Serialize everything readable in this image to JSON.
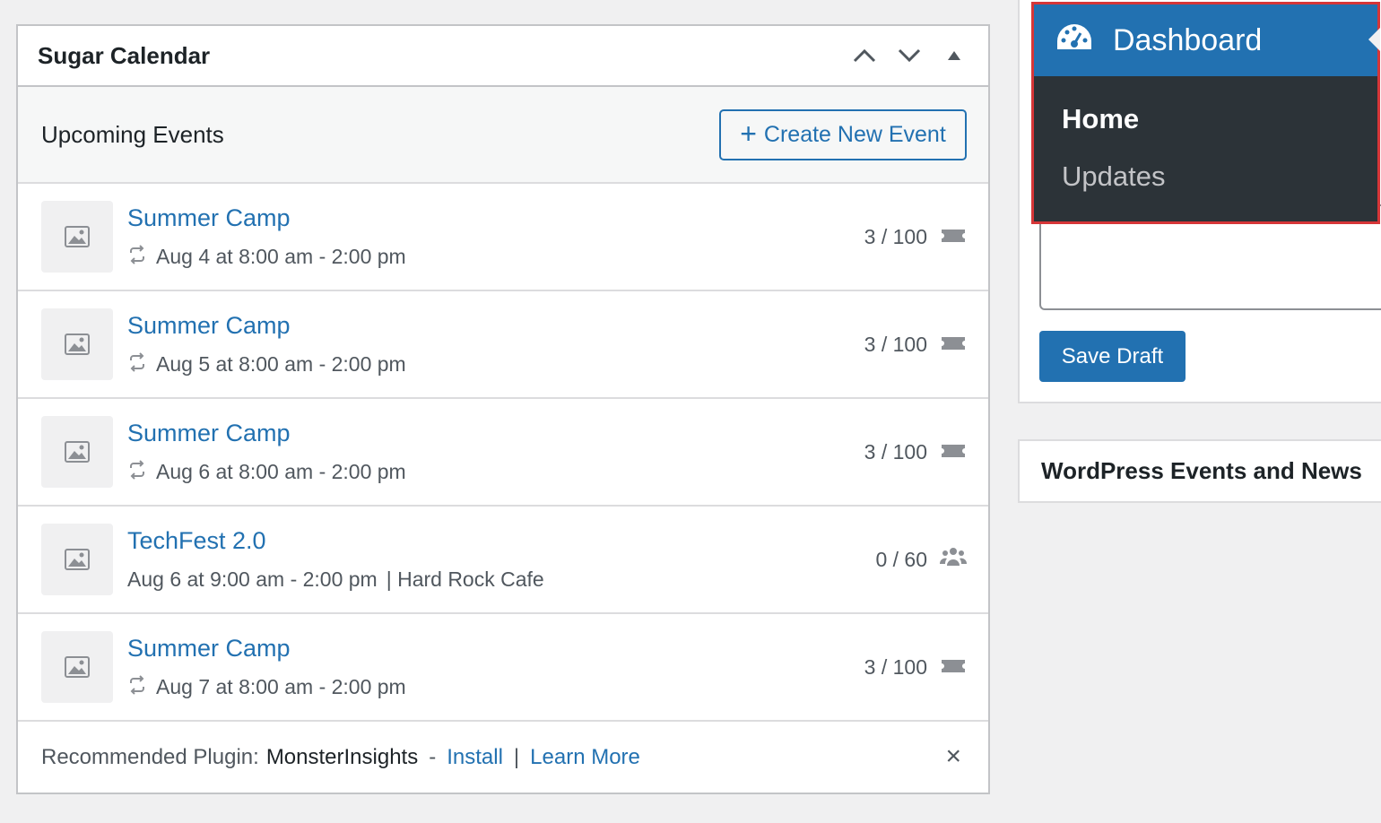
{
  "widget": {
    "title": "Sugar Calendar",
    "subtitle": "Upcoming Events",
    "create_label": "Create New Event",
    "events": [
      {
        "title": "Summer Camp",
        "meta": "Aug 4 at 8:00 am - 2:00 pm",
        "count": "3 / 100",
        "recurring": true,
        "icon": "ticket-icon"
      },
      {
        "title": "Summer Camp",
        "meta": "Aug 5 at 8:00 am - 2:00 pm",
        "count": "3 / 100",
        "recurring": true,
        "icon": "ticket-icon"
      },
      {
        "title": "Summer Camp",
        "meta": "Aug 6 at 8:00 am - 2:00 pm",
        "count": "3 / 100",
        "recurring": true,
        "icon": "ticket-icon"
      },
      {
        "title": "TechFest 2.0",
        "meta": "Aug 6 at 9:00 am - 2:00 pm",
        "location": "| Hard Rock Cafe",
        "count": "0 / 60",
        "recurring": false,
        "icon": "attendees-icon"
      },
      {
        "title": "Summer Camp",
        "meta": "Aug 7 at 8:00 am - 2:00 pm",
        "count": "3 / 100",
        "recurring": true,
        "icon": "ticket-icon"
      }
    ],
    "footer": {
      "prefix": "Recommended Plugin:",
      "plugin": "MonsterInsights",
      "dash": "-",
      "install": "Install",
      "pipe": "|",
      "learn_more": "Learn More"
    }
  },
  "sidebar_menu": {
    "top_label": "Dashboard",
    "items": [
      {
        "label": "Home"
      },
      {
        "label": "Updates"
      }
    ]
  },
  "draft": {
    "save_label": "Save Draft"
  },
  "news": {
    "title": "WordPress Events and News"
  },
  "colors": {
    "accent": "#2271b1",
    "menu_bg": "#2c3338",
    "highlight": "#d63638"
  }
}
